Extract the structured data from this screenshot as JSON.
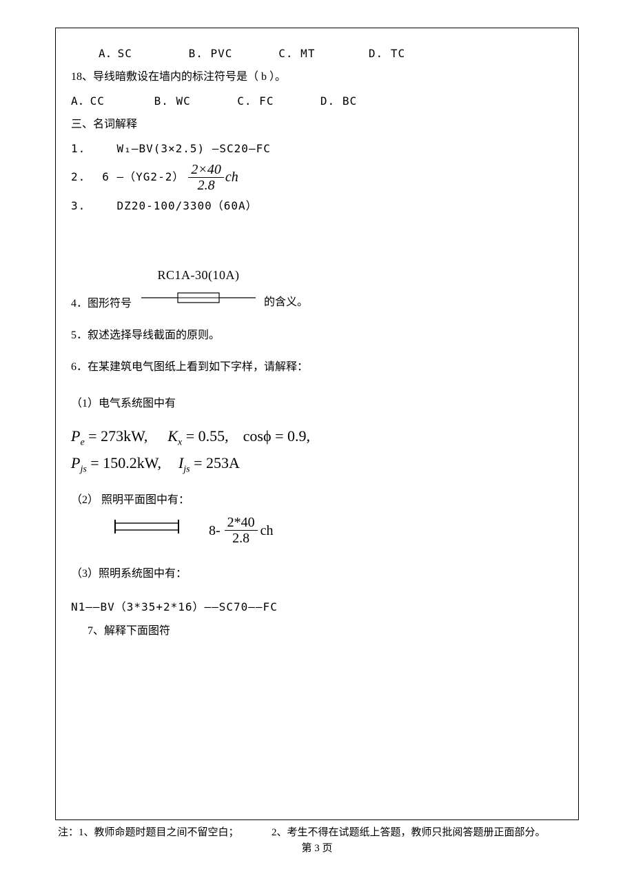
{
  "q17": {
    "indent": true,
    "a": "A．SC",
    "b": "B. PVC",
    "c": "C. MT",
    "d": "D. TC"
  },
  "q18": {
    "stem": "18、导线暗敷设在墙内的标注符号是（  b  ）。",
    "a": "A．CC",
    "b": "B. WC",
    "c": "C. FC",
    "d": "D. BC"
  },
  "sec3_title": "三、名词解释",
  "t1": {
    "label": "1.",
    "text": "W₁—BV(3×2.5) —SC20—FC"
  },
  "t2": {
    "label": "2.",
    "prefix": "6 —（YG2-2）",
    "frac_num": "2×40",
    "frac_den": "2.8",
    "suffix": "ch"
  },
  "t3": {
    "label": "3.",
    "text": "DZ20-100/3300（60A）"
  },
  "t4": {
    "label": "4．图形符号",
    "fuse_label": "RC1A-30(10A)",
    "tail": "的含义。"
  },
  "t5": "5．叙述选择导线截面的原则。",
  "t6": "6．在某建筑电气图纸上看到如下字样，请解释：",
  "t6_1_label": "（1）电气系统图中有",
  "eq": {
    "line1_a": "P",
    "line1_a_sub": "e",
    "line1_a_rest": " = 273kW,",
    "line1_b": "K",
    "line1_b_sub": "x",
    "line1_b_rest": " = 0.55,",
    "line1_c": "cosϕ = 0.9,",
    "line2_a": "P",
    "line2_a_sub": "js",
    "line2_a_rest": " = 150.2kW,",
    "line2_b": "I",
    "line2_b_sub": "js",
    "line2_b_rest": " = 253A"
  },
  "t6_2_label": "（2） 照明平面图中有：",
  "lamp": {
    "lead": "8-",
    "num": "2*40",
    "den": "2.8",
    "unit": "ch"
  },
  "t6_3_label": "（3）照明系统图中有：",
  "t6_3_line": "N1——BV（3*35+2*16）——SC70——FC",
  "t7": "7、解释下面图符",
  "footer_left": "注：1、教师命题时题目之间不留空白；",
  "footer_right": "2、考生不得在试题纸上答题，教师只批阅答题册正面部分。",
  "page_no": "第 3 页"
}
